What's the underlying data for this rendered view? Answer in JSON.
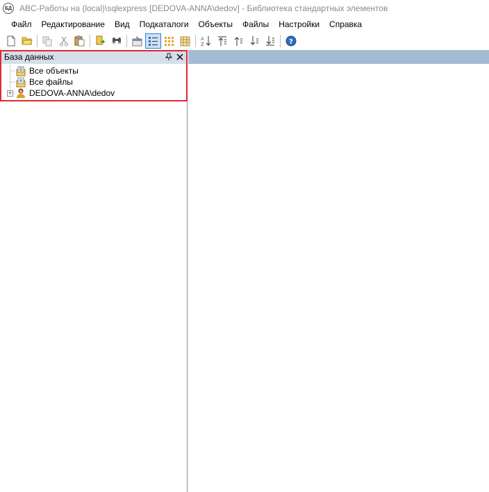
{
  "window": {
    "app_icon": "БД",
    "title": "ABC-Работы на (local)\\sqlexpress [DEDOVA-ANNA\\dedov] - Библиотека стандартных элементов"
  },
  "menu": [
    "Файл",
    "Редактирование",
    "Вид",
    "Подкаталоги",
    "Объекты",
    "Файлы",
    "Настройки",
    "Справка"
  ],
  "toolbar": {
    "buttons": [
      {
        "icon": "new-file-icon"
      },
      {
        "icon": "open-folder-icon"
      },
      {
        "icon": "copy-icon"
      },
      {
        "icon": "cut-icon"
      },
      {
        "icon": "paste-icon"
      },
      {
        "icon": "export-icon"
      },
      {
        "icon": "find-icon"
      },
      {
        "icon": "properties-icon"
      },
      {
        "icon": "details-view-icon",
        "active": true
      },
      {
        "icon": "large-icons-view-icon"
      },
      {
        "icon": "list-view-icon"
      },
      {
        "icon": "sort-az-icon"
      },
      {
        "icon": "move-top-icon"
      },
      {
        "icon": "move-up-icon"
      },
      {
        "icon": "move-down-icon"
      },
      {
        "icon": "move-bottom-icon"
      },
      {
        "icon": "help-icon"
      }
    ]
  },
  "left_panel": {
    "title": "База данных",
    "tree": [
      {
        "label": "Все объекты",
        "icon": "all-objects-icon"
      },
      {
        "label": "Все файлы",
        "icon": "all-files-icon"
      },
      {
        "label": "DEDOVA-ANNA\\dedov",
        "icon": "user-icon",
        "expander": "+"
      }
    ]
  },
  "colors": {
    "highlight": "#e22730",
    "panel_header": "#d6dfe9",
    "right_header": "#a3bcd6",
    "active_button": "#cce0f7"
  }
}
